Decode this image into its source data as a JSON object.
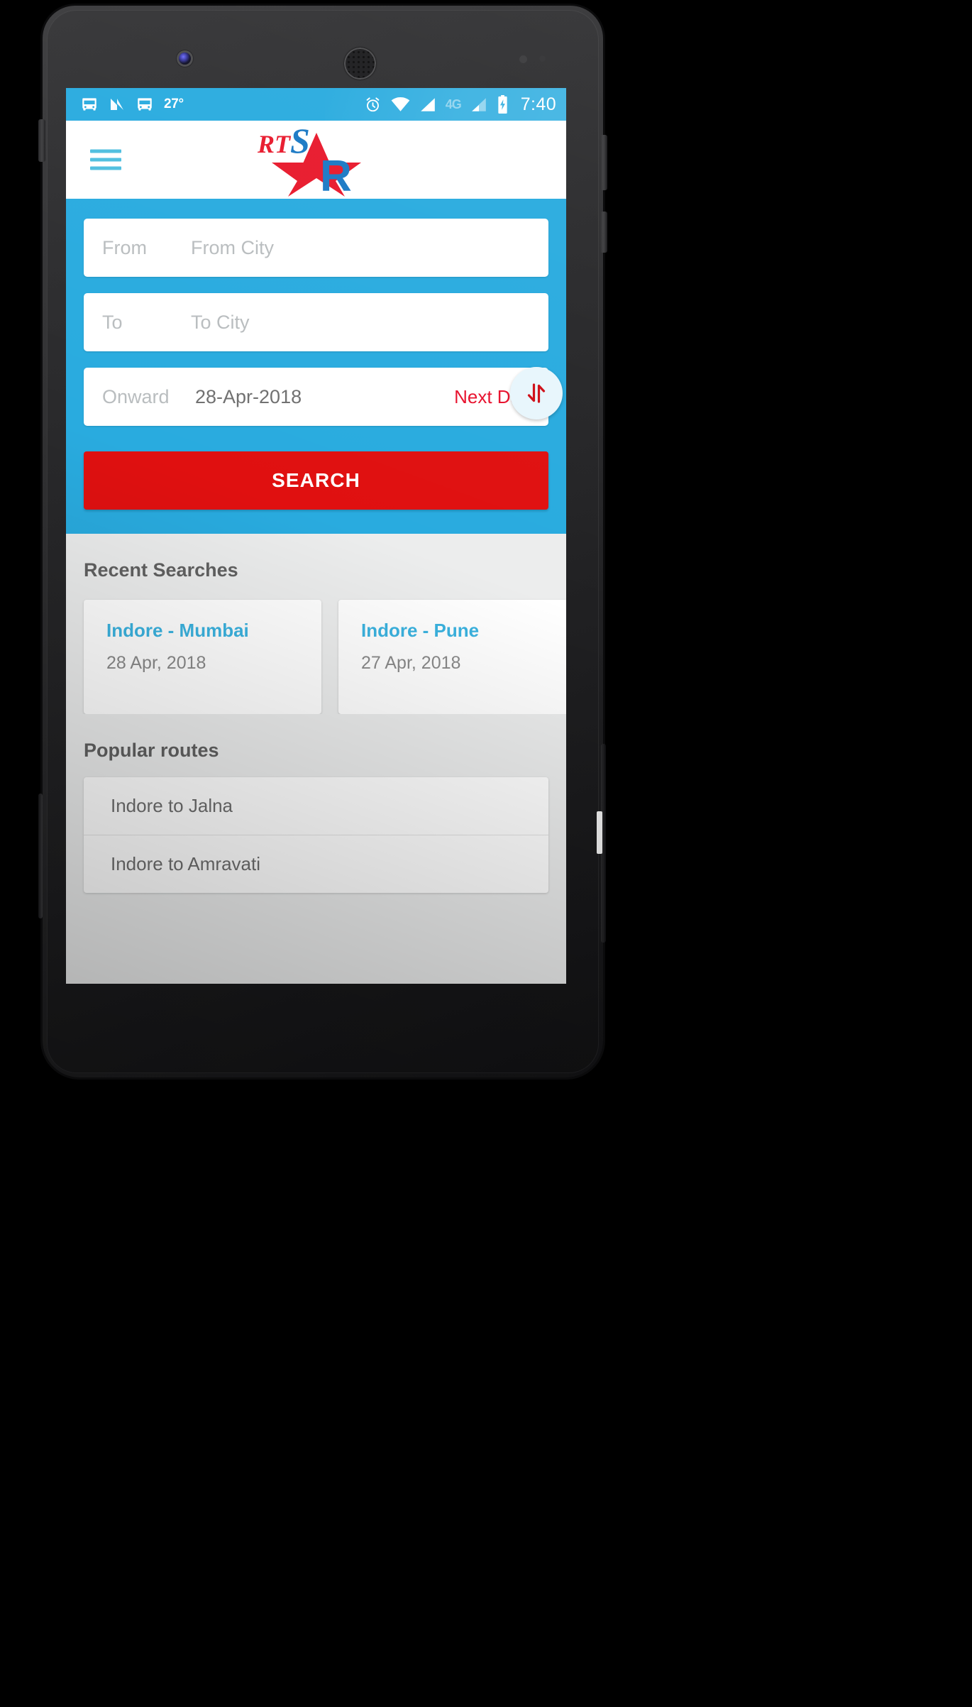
{
  "statusbar": {
    "icons_left": [
      "bus-icon",
      "nova-launcher-icon",
      "bus-icon"
    ],
    "temperature": "27°",
    "icons_right": [
      "alarm-icon",
      "wifi-icon",
      "signal-icon",
      "network-4g-icon",
      "signal-2-icon",
      "battery-charging-icon"
    ],
    "network_label": "4G",
    "time": "7:40"
  },
  "appbar": {
    "menu_icon": "hamburger-menu-icon",
    "logo_text_rt": "RT",
    "logo_text_s": "S",
    "logo_text_r": "R",
    "logo_alt": "RTSR logo"
  },
  "search_panel": {
    "from": {
      "label": "From",
      "placeholder": "From City",
      "value": ""
    },
    "to": {
      "label": "To",
      "placeholder": "To City",
      "value": ""
    },
    "swap_icon": "swap-arrows-icon",
    "onward": {
      "label": "Onward",
      "date": "28-Apr-2018",
      "next_day": "Next Day"
    },
    "search_button": "SEARCH"
  },
  "recent": {
    "title": "Recent Searches",
    "items": [
      {
        "route": "Indore - Mumbai",
        "date": "28 Apr, 2018"
      },
      {
        "route": "Indore - Pune",
        "date": "27 Apr, 2018"
      }
    ]
  },
  "popular": {
    "title": "Popular routes",
    "items": [
      {
        "label": "Indore to Jalna"
      },
      {
        "label": "Indore to Amravati"
      }
    ]
  },
  "colors": {
    "accent_blue": "#29ABDF",
    "accent_red": "#E01010",
    "link_blue": "#3BB3E0",
    "next_day_red": "#E8112D",
    "body_grey": "#ECEDED"
  }
}
